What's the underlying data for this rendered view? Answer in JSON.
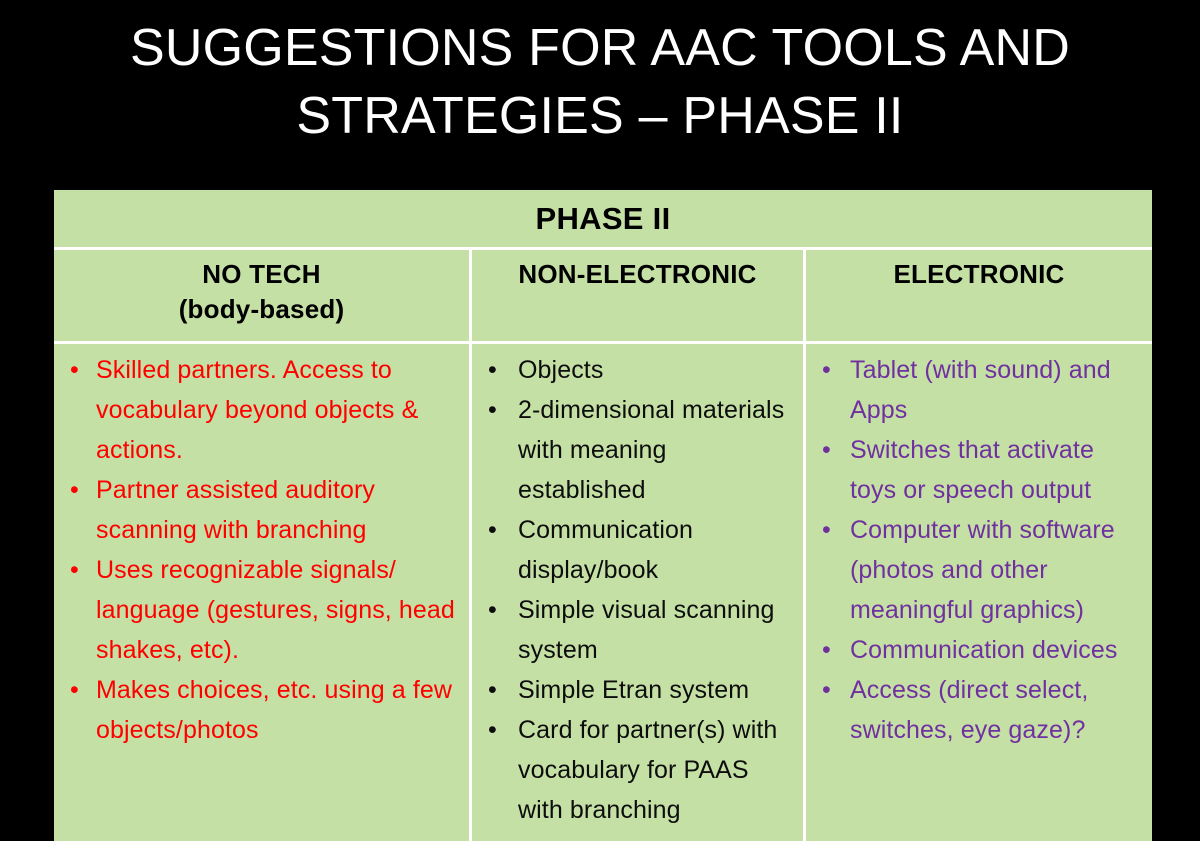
{
  "slide": {
    "title": "SUGGESTIONS FOR AAC TOOLS AND\nSTRATEGIES – PHASE II",
    "background_color": "#000000",
    "title_color": "#FFFFFF"
  },
  "table": {
    "banner_label": "PHASE II",
    "banner_background": "#C5E0A5",
    "grid_line_color": "#FFFFFF",
    "columns": [
      {
        "id": "no-tech",
        "header": "NO TECH",
        "subheader": "(body-based)",
        "text_color": "#FF0000",
        "items": [
          "Skilled partners. Access to vocabulary beyond objects & actions.",
          "Partner assisted auditory scanning with branching",
          "Uses recognizable signals/ language (gestures, signs, head shakes, etc).",
          "Makes choices, etc. using a few objects/photos"
        ]
      },
      {
        "id": "non-electronic",
        "header": "NON-ELECTRONIC",
        "subheader": "",
        "text_color": "#0D0D0D",
        "items": [
          "Objects",
          "2-dimensional materials with meaning established",
          "Communication display/book",
          "Simple visual scanning system",
          "Simple Etran system",
          "Card for partner(s) with vocabulary for PAAS with branching"
        ]
      },
      {
        "id": "electronic",
        "header": "ELECTRONIC",
        "subheader": "",
        "text_color": "#7030A0",
        "items": [
          "Tablet (with sound) and Apps",
          "Switches that activate toys or speech output",
          "Computer with software (photos and other meaningful graphics)",
          "Communication devices",
          "Access (direct select, switches, eye gaze)?"
        ]
      }
    ]
  }
}
